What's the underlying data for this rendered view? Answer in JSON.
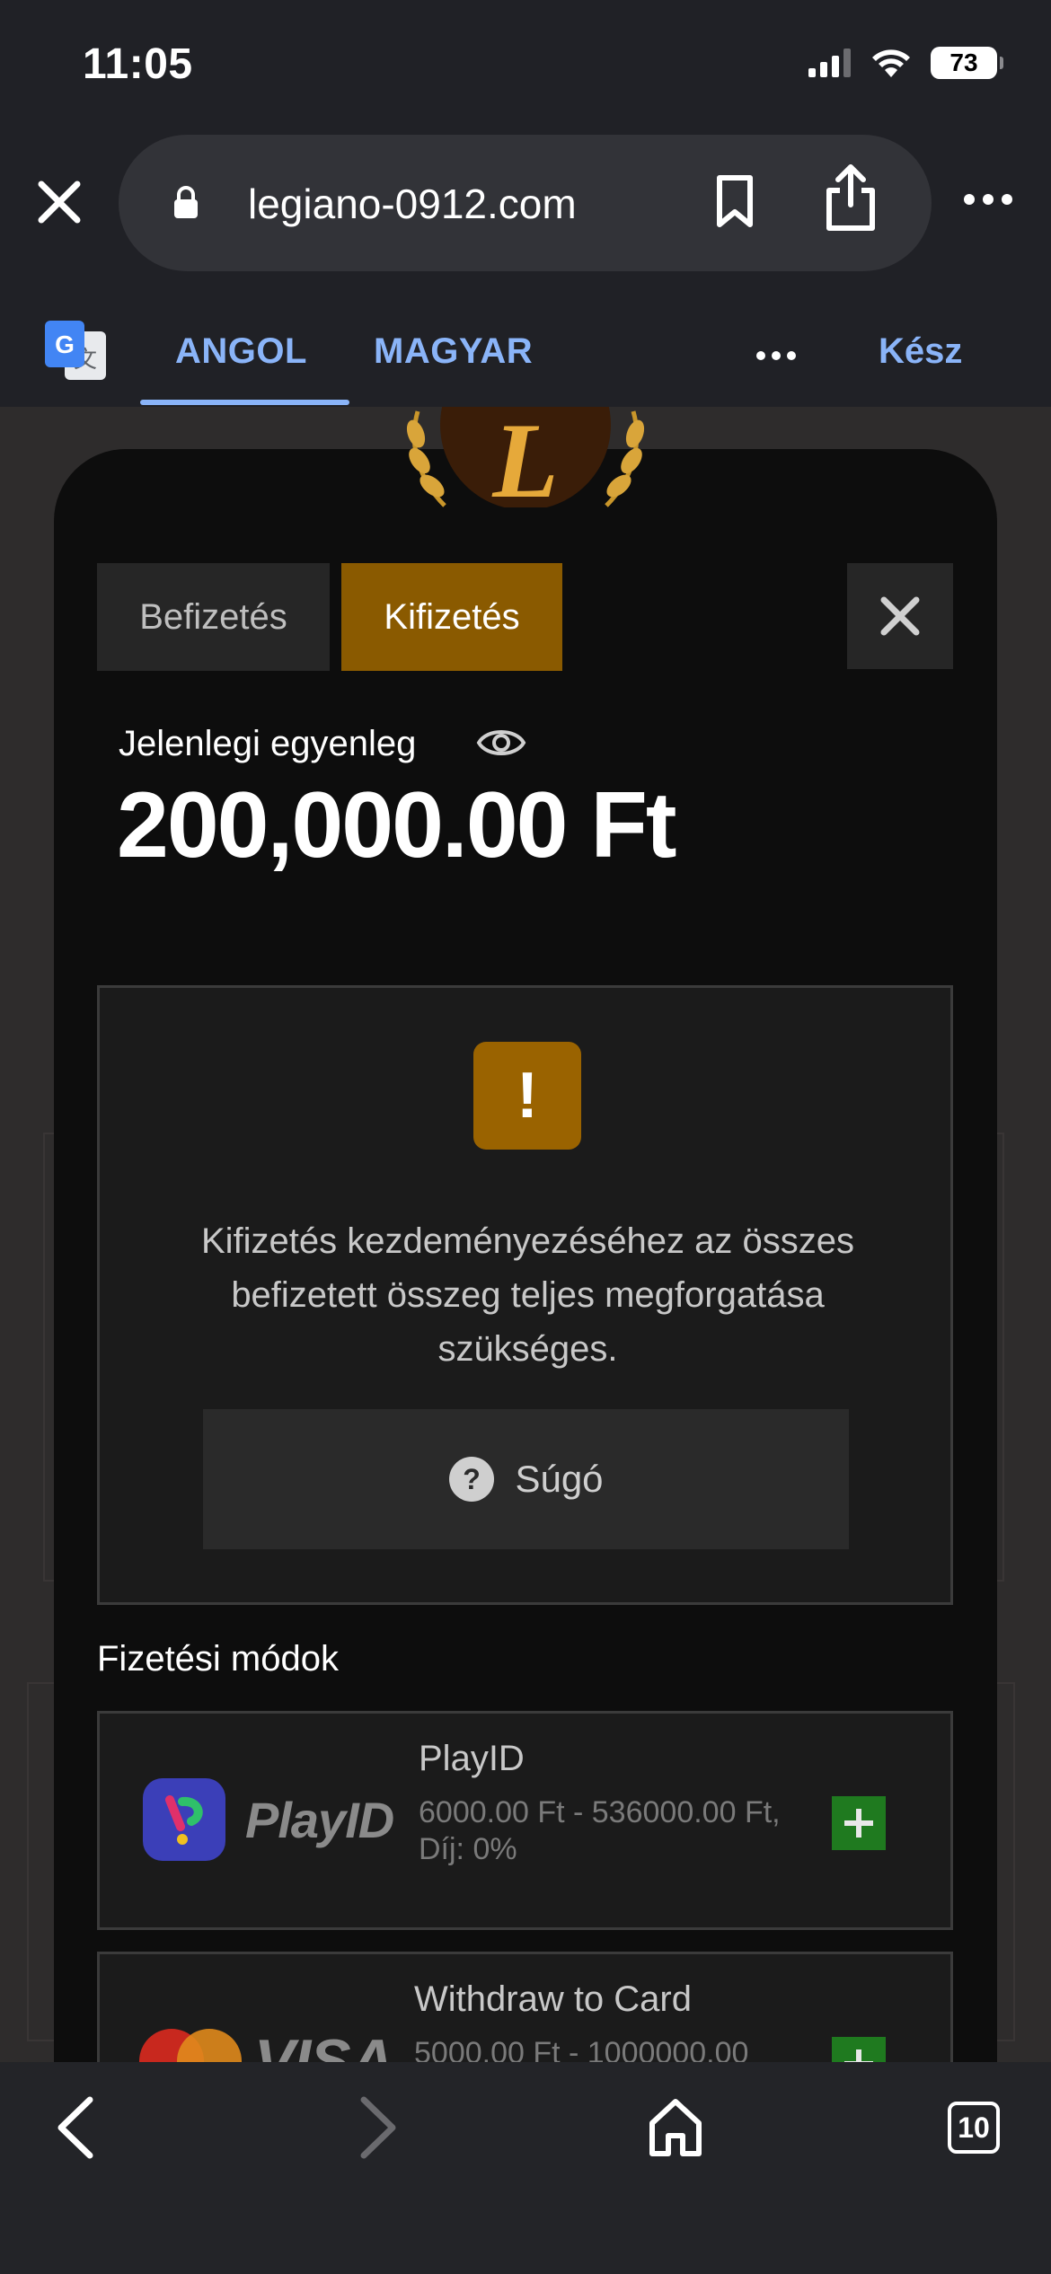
{
  "status_bar": {
    "time": "11:05",
    "battery": "73"
  },
  "browser": {
    "url": "legiano-0912.com",
    "translate": {
      "source_lang": "ANGOL",
      "target_lang": "MAGYAR",
      "done_label": "Kész"
    },
    "tabs_count": "10"
  },
  "modal": {
    "tabs": {
      "deposit": "Befizetés",
      "withdraw": "Kifizetés"
    },
    "balance_label": "Jelenlegi egyenleg",
    "balance_value": "200,000.00 Ft",
    "notice": {
      "icon": "!",
      "text": "Kifizetés kezdeményezéséhez az összes befizetett összeg teljes megforgatása szükséges.",
      "help_label": "Súgó"
    },
    "methods_title": "Fizetési módok",
    "methods": [
      {
        "logo": "PlayID",
        "name": "PlayID",
        "range": "6000.00 Ft - 536000.00 Ft,",
        "fee": "Díj: 0%"
      },
      {
        "logo": "VISA",
        "name": "Withdraw to Card",
        "range": "5000.00 Ft - 1000000.00"
      }
    ]
  },
  "colors": {
    "accent": "#8a5a00",
    "link": "#8ab4f8",
    "add": "#1f7a1f",
    "modal_bg": "#0d0d0d"
  }
}
